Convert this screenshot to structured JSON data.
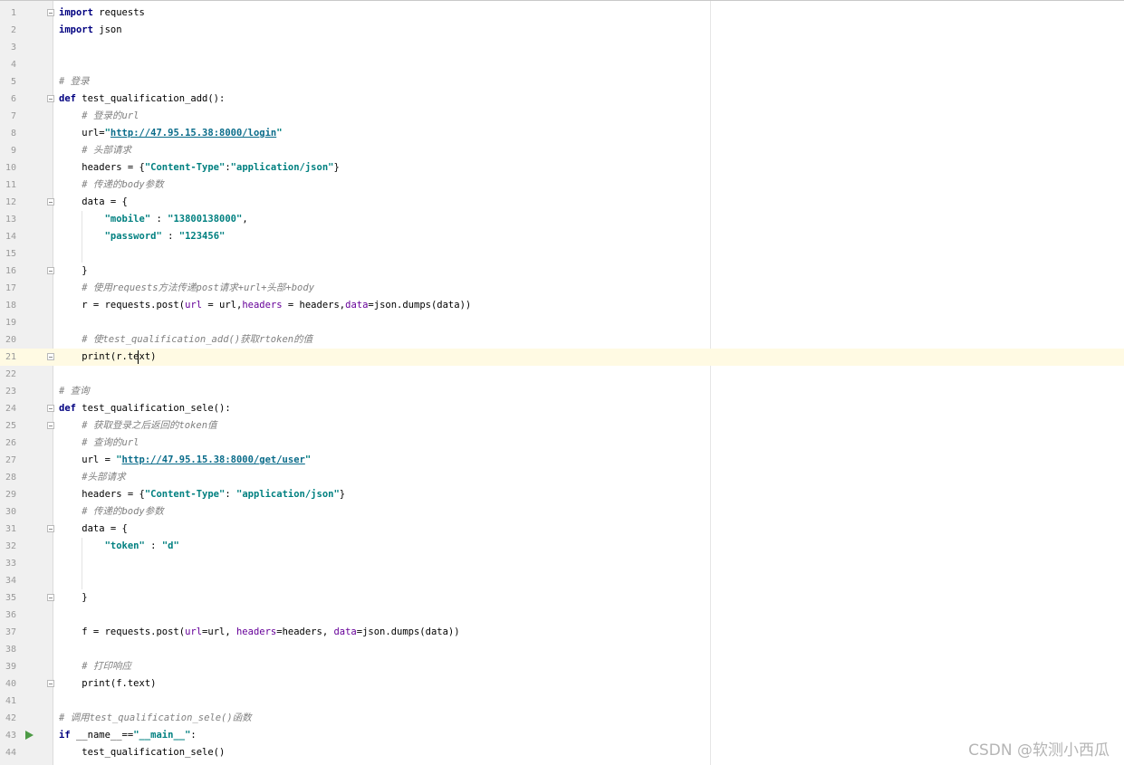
{
  "editor": {
    "current_line": 21,
    "colors": {
      "keyword": "#000080",
      "comment": "#808080",
      "string": "#008080",
      "link": "#0a6c8a",
      "param": "#660099",
      "run_marker": "#4c9a45",
      "current_line_bg": "#fffae3"
    },
    "lines": [
      {
        "n": "1",
        "fold": true,
        "tokens": [
          {
            "t": "kw",
            "v": "import"
          },
          {
            "t": "tx",
            "v": " requests"
          }
        ]
      },
      {
        "n": "2",
        "tokens": [
          {
            "t": "kw",
            "v": "import"
          },
          {
            "t": "tx",
            "v": " json"
          }
        ]
      },
      {
        "n": "3",
        "tokens": []
      },
      {
        "n": "4",
        "tokens": []
      },
      {
        "n": "5",
        "tokens": [
          {
            "t": "cm",
            "v": "# 登录"
          }
        ]
      },
      {
        "n": "6",
        "fold": true,
        "tokens": [
          {
            "t": "kw",
            "v": "def"
          },
          {
            "t": "tx",
            "v": " test_qualification_add():"
          }
        ]
      },
      {
        "n": "7",
        "tokens": [
          {
            "t": "tx",
            "v": "    "
          },
          {
            "t": "cm",
            "v": "# 登录的url"
          }
        ]
      },
      {
        "n": "8",
        "tokens": [
          {
            "t": "tx",
            "v": "    url="
          },
          {
            "t": "st",
            "v": "\""
          },
          {
            "t": "lk",
            "v": "http://47.95.15.38:8000/login"
          },
          {
            "t": "st",
            "v": "\""
          }
        ]
      },
      {
        "n": "9",
        "tokens": [
          {
            "t": "tx",
            "v": "    "
          },
          {
            "t": "cm",
            "v": "# 头部请求"
          }
        ]
      },
      {
        "n": "10",
        "tokens": [
          {
            "t": "tx",
            "v": "    headers = {"
          },
          {
            "t": "st",
            "v": "\"Content-Type\""
          },
          {
            "t": "tx",
            "v": ":"
          },
          {
            "t": "st",
            "v": "\"application/json\""
          },
          {
            "t": "tx",
            "v": "}"
          }
        ]
      },
      {
        "n": "11",
        "tokens": [
          {
            "t": "tx",
            "v": "    "
          },
          {
            "t": "cm",
            "v": "# 传递的body参数"
          }
        ]
      },
      {
        "n": "12",
        "fold": true,
        "tokens": [
          {
            "t": "tx",
            "v": "    data = {"
          }
        ]
      },
      {
        "n": "13",
        "tokens": [
          {
            "t": "tx",
            "v": "        "
          },
          {
            "t": "st",
            "v": "\"mobile\""
          },
          {
            "t": "tx",
            "v": " : "
          },
          {
            "t": "st",
            "v": "\"13800138000\""
          },
          {
            "t": "tx",
            "v": ","
          }
        ]
      },
      {
        "n": "14",
        "tokens": [
          {
            "t": "tx",
            "v": "        "
          },
          {
            "t": "st",
            "v": "\"password\""
          },
          {
            "t": "tx",
            "v": " : "
          },
          {
            "t": "st",
            "v": "\"123456\""
          }
        ]
      },
      {
        "n": "15",
        "tokens": []
      },
      {
        "n": "16",
        "fold": true,
        "tokens": [
          {
            "t": "tx",
            "v": "    }"
          }
        ]
      },
      {
        "n": "17",
        "tokens": [
          {
            "t": "tx",
            "v": "    "
          },
          {
            "t": "cm",
            "v": "# 使用requests方法传递post请求+url+头部+body"
          }
        ]
      },
      {
        "n": "18",
        "tokens": [
          {
            "t": "tx",
            "v": "    r = requests.post("
          },
          {
            "t": "pm",
            "v": "url"
          },
          {
            "t": "tx",
            "v": " = url,"
          },
          {
            "t": "pm",
            "v": "headers"
          },
          {
            "t": "tx",
            "v": " = headers,"
          },
          {
            "t": "pm",
            "v": "data"
          },
          {
            "t": "tx",
            "v": "=json.dumps(data))"
          }
        ]
      },
      {
        "n": "19",
        "tokens": []
      },
      {
        "n": "20",
        "tokens": [
          {
            "t": "tx",
            "v": "    "
          },
          {
            "t": "cm",
            "v": "# 使test_qualification_add()获取rtoken的值"
          }
        ]
      },
      {
        "n": "21",
        "fold": true,
        "caret": 11,
        "tokens": [
          {
            "t": "tx",
            "v": "    print(r.text)"
          }
        ]
      },
      {
        "n": "22",
        "tokens": []
      },
      {
        "n": "23",
        "tokens": [
          {
            "t": "cm",
            "v": "# 查询"
          }
        ]
      },
      {
        "n": "24",
        "fold": true,
        "tokens": [
          {
            "t": "kw",
            "v": "def"
          },
          {
            "t": "tx",
            "v": " test_qualification_sele():"
          }
        ]
      },
      {
        "n": "25",
        "fold": true,
        "tokens": [
          {
            "t": "tx",
            "v": "    "
          },
          {
            "t": "cm",
            "v": "# 获取登录之后返回的token值"
          }
        ]
      },
      {
        "n": "26",
        "tokens": [
          {
            "t": "tx",
            "v": "    "
          },
          {
            "t": "cm",
            "v": "# 查询的url"
          }
        ]
      },
      {
        "n": "27",
        "tokens": [
          {
            "t": "tx",
            "v": "    url = "
          },
          {
            "t": "st",
            "v": "\""
          },
          {
            "t": "lk",
            "v": "http://47.95.15.38:8000/get/user"
          },
          {
            "t": "st",
            "v": "\""
          }
        ]
      },
      {
        "n": "28",
        "tokens": [
          {
            "t": "tx",
            "v": "    "
          },
          {
            "t": "cm",
            "v": "#头部请求"
          }
        ]
      },
      {
        "n": "29",
        "tokens": [
          {
            "t": "tx",
            "v": "    headers = {"
          },
          {
            "t": "st",
            "v": "\"Content-Type\""
          },
          {
            "t": "tx",
            "v": ": "
          },
          {
            "t": "st",
            "v": "\"application/json\""
          },
          {
            "t": "tx",
            "v": "}"
          }
        ]
      },
      {
        "n": "30",
        "tokens": [
          {
            "t": "tx",
            "v": "    "
          },
          {
            "t": "cm",
            "v": "# 传递的body参数"
          }
        ]
      },
      {
        "n": "31",
        "fold": true,
        "tokens": [
          {
            "t": "tx",
            "v": "    data = {"
          }
        ]
      },
      {
        "n": "32",
        "tokens": [
          {
            "t": "tx",
            "v": "        "
          },
          {
            "t": "st",
            "v": "\"token\""
          },
          {
            "t": "tx",
            "v": " : "
          },
          {
            "t": "st",
            "v": "\"d\""
          }
        ]
      },
      {
        "n": "33",
        "tokens": []
      },
      {
        "n": "34",
        "tokens": []
      },
      {
        "n": "35",
        "fold": true,
        "tokens": [
          {
            "t": "tx",
            "v": "    }"
          }
        ]
      },
      {
        "n": "36",
        "tokens": []
      },
      {
        "n": "37",
        "tokens": [
          {
            "t": "tx",
            "v": "    f = requests.post("
          },
          {
            "t": "pm",
            "v": "url"
          },
          {
            "t": "tx",
            "v": "=url, "
          },
          {
            "t": "pm",
            "v": "headers"
          },
          {
            "t": "tx",
            "v": "=headers, "
          },
          {
            "t": "pm",
            "v": "data"
          },
          {
            "t": "tx",
            "v": "=json.dumps(data))"
          }
        ]
      },
      {
        "n": "38",
        "tokens": []
      },
      {
        "n": "39",
        "tokens": [
          {
            "t": "tx",
            "v": "    "
          },
          {
            "t": "cm",
            "v": "# 打印响应"
          }
        ]
      },
      {
        "n": "40",
        "fold": true,
        "tokens": [
          {
            "t": "tx",
            "v": "    print(f.text)"
          }
        ]
      },
      {
        "n": "41",
        "tokens": []
      },
      {
        "n": "42",
        "tokens": [
          {
            "t": "cm",
            "v": "# 调用test_qualification_sele()函数"
          }
        ]
      },
      {
        "n": "43",
        "run": true,
        "tokens": [
          {
            "t": "kw",
            "v": "if"
          },
          {
            "t": "tx",
            "v": " __name__=="
          },
          {
            "t": "st",
            "v": "\"__main__\""
          },
          {
            "t": "tx",
            "v": ":"
          }
        ]
      },
      {
        "n": "44",
        "tokens": [
          {
            "t": "tx",
            "v": "    test_qualification_sele()"
          }
        ]
      }
    ]
  },
  "watermark": "CSDN @软测小西瓜"
}
